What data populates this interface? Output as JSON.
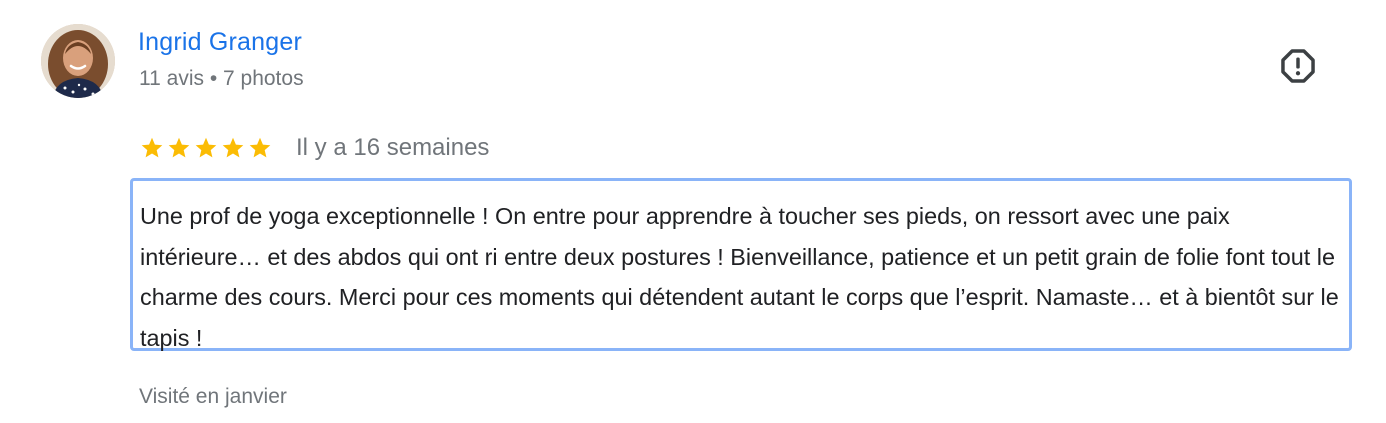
{
  "review": {
    "author": {
      "name": "Ingrid Granger",
      "meta": "11 avis • 7 photos"
    },
    "rating": {
      "stars": 5,
      "max": 5,
      "color": "#fbbc04"
    },
    "date": "Il y a 16 semaines",
    "text": "Une prof de yoga exceptionnelle ! On entre pour apprendre à toucher ses pieds, on ressort avec une paix intérieure… et des abdos qui ont ri entre deux postures ! Bienveillance, patience et un petit grain de folie font tout le charme des cours. Merci pour ces moments qui détendent autant le corps que l’esprit. Namaste… et à bientôt sur le tapis !",
    "visited": "Visité en janvier",
    "report_icon": "report-flag-icon"
  },
  "colors": {
    "accent": "#1a73e8",
    "secondary_text": "#70757a",
    "focus_border": "#8ab4f8"
  }
}
